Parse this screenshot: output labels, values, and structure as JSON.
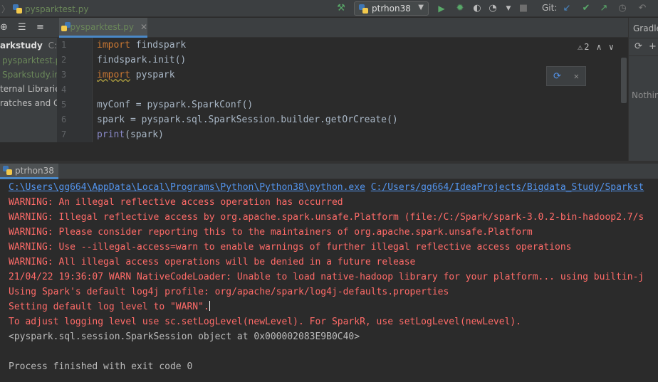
{
  "toolbar": {
    "file_name": "pysparktest.py",
    "run_config": "ptrhon38",
    "git_label": "Git:"
  },
  "project": {
    "items": [
      {
        "label": "arkstudy",
        "path_hint": "C:\\U"
      },
      {
        "label": "pysparktest.py"
      },
      {
        "label": "Sparkstudy.im"
      },
      {
        "label": "ternal Libraries"
      },
      {
        "label": "ratches and Co"
      }
    ]
  },
  "editor": {
    "tab_label": "pysparktest.py",
    "line_numbers": [
      "1",
      "2",
      "3",
      "4",
      "5",
      "6",
      "7"
    ],
    "code": {
      "l1_kw": "import",
      "l1_rest": " findspark",
      "l2": "findspark.init()",
      "l3_kw": "import",
      "l3_rest": " pyspark",
      "l5": "myConf = pyspark.SparkConf()",
      "l6": "spark = pyspark.sql.SparkSession.builder.getOrCreate()",
      "l7_fn": "print",
      "l7_rest": "(spark)"
    },
    "warning_count": "2"
  },
  "gradle": {
    "title": "Gradle",
    "empty_text": "Nothing"
  },
  "run": {
    "tab_label": "ptrhon38",
    "console": {
      "cmd_exe": "C:\\Users\\gg664\\AppData\\Local\\Programs\\Python\\Python38\\python.exe",
      "cmd_script": "C:/Users/gg664/IdeaProjects/Bigdata_Study/Sparkst",
      "lines": [
        "WARNING: An illegal reflective access operation has occurred",
        "WARNING: Illegal reflective access by org.apache.spark.unsafe.Platform (file:/C:/Spark/spark-3.0.2-bin-hadoop2.7/s",
        "WARNING: Please consider reporting this to the maintainers of org.apache.spark.unsafe.Platform",
        "WARNING: Use --illegal-access=warn to enable warnings of further illegal reflective access operations",
        "WARNING: All illegal access operations will be denied in a future release",
        "21/04/22 19:36:07 WARN NativeCodeLoader: Unable to load native-hadoop library for your platform... using builtin-j",
        "Using Spark's default log4j profile: org/apache/spark/log4j-defaults.properties",
        "Setting default log level to \"WARN\".",
        "To adjust logging level use sc.setLogLevel(newLevel). For SparkR, use setLogLevel(newLevel)."
      ],
      "result": "<pyspark.sql.session.SparkSession object at 0x000002083E9B0C40>",
      "exit_msg": "Process finished with exit code 0"
    }
  },
  "colors": {
    "error": "#ff6b68",
    "link": "#5394ec",
    "keyword": "#cc7832",
    "accent": "#4a88c7"
  }
}
